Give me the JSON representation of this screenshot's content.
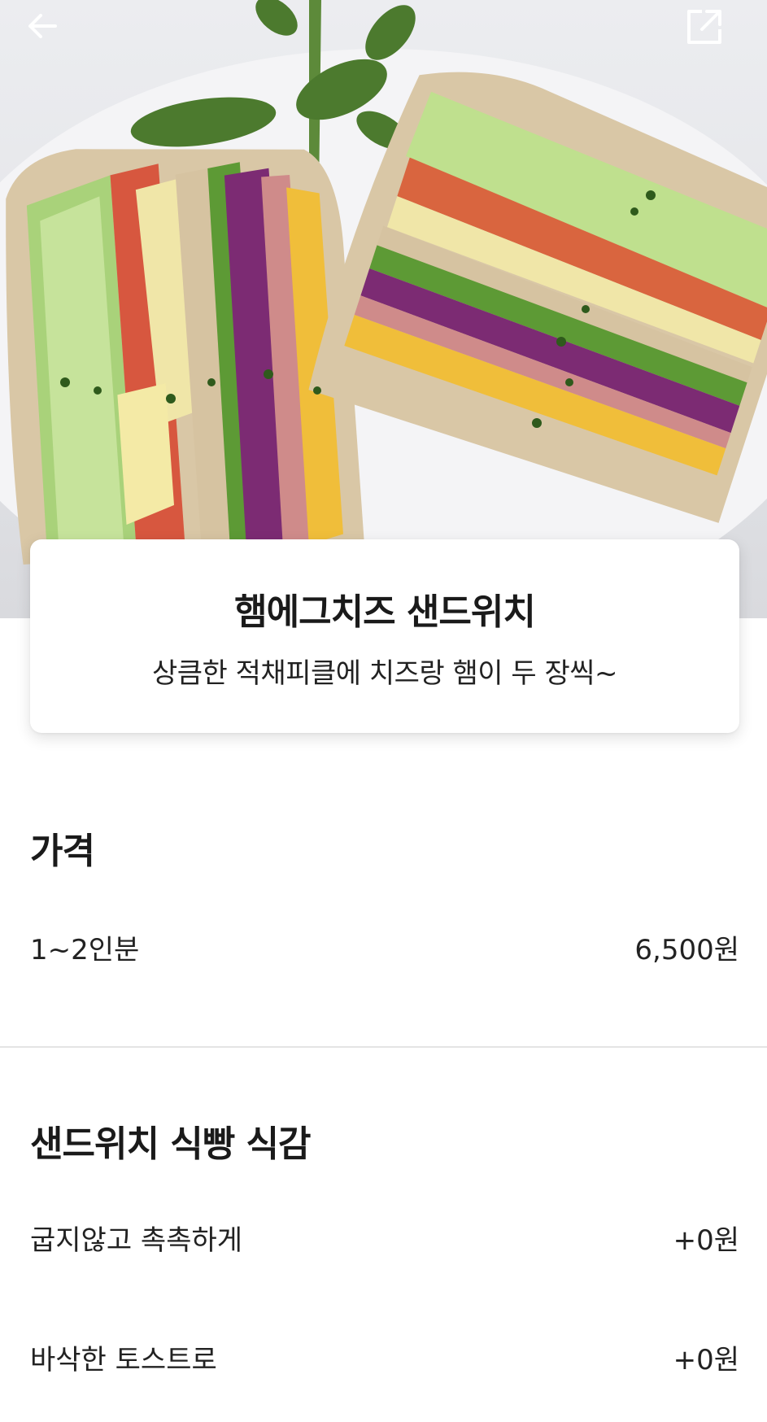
{
  "hero": {
    "back_icon": "arrow-left-icon",
    "share_icon": "share-external-icon"
  },
  "product": {
    "name": "햄에그치즈 샌드위치",
    "description": "상큼한 적채피클에 치즈랑 햄이 두 장씩~"
  },
  "price_section": {
    "title": "가격",
    "options": [
      {
        "label": "1~2인분",
        "price": "6,500원"
      }
    ]
  },
  "bread_section": {
    "title": "샌드위치 식빵 식감",
    "options": [
      {
        "label": "굽지않고 촉촉하게",
        "price": "+0원"
      },
      {
        "label": "바삭한 토스트로",
        "price": "+0원"
      }
    ]
  }
}
